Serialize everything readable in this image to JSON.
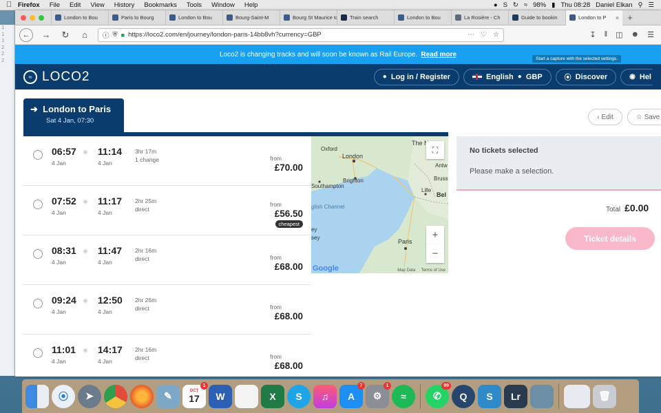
{
  "menubar": {
    "app": "Firefox",
    "items": [
      "File",
      "Edit",
      "View",
      "History",
      "Bookmarks",
      "Tools",
      "Window",
      "Help"
    ],
    "battery": "98%",
    "clock": "Thu 08:28",
    "user": "Daniel Elkan"
  },
  "tabs": [
    {
      "label": "London to Bou"
    },
    {
      "label": "Paris to Bourg"
    },
    {
      "label": "London to Bou"
    },
    {
      "label": "Bourg-Saint-M"
    },
    {
      "label": "Bourg St Maurice to"
    },
    {
      "label": "Train search"
    },
    {
      "label": "London to Bou"
    },
    {
      "label": "La Rosière - Ch"
    },
    {
      "label": "Guide to bookin"
    },
    {
      "label": "London to P"
    }
  ],
  "url": "https://loco2.com/en/journey/london-paris-14bb8vh?currency=GBP",
  "banner": {
    "text": "Loco2 is changing tracks and will soon be known as Rail Europe.",
    "link": "Read more",
    "capture": "Start a capture with the selected settings."
  },
  "header": {
    "logo": "LOCO2",
    "login": "Log in / Register",
    "language": "English",
    "currency": "GBP",
    "discover": "Discover",
    "help": "Hel"
  },
  "journey": {
    "route": "London to Paris",
    "date": "Sat 4 Jan, 07:30"
  },
  "results": [
    {
      "dep": "06:57",
      "dep_date": "4 Jan",
      "arr": "11:14",
      "arr_date": "4 Jan",
      "duration": "3hr 17m",
      "changes": "1 change",
      "from": "from",
      "price": "£70.00",
      "badge": ""
    },
    {
      "dep": "07:52",
      "dep_date": "4 Jan",
      "arr": "11:17",
      "arr_date": "4 Jan",
      "duration": "2hr 25m",
      "changes": "direct",
      "from": "from",
      "price": "£56.50",
      "badge": "cheapest"
    },
    {
      "dep": "08:31",
      "dep_date": "4 Jan",
      "arr": "11:47",
      "arr_date": "4 Jan",
      "duration": "2hr 16m",
      "changes": "direct",
      "from": "from",
      "price": "£68.00",
      "badge": ""
    },
    {
      "dep": "09:24",
      "dep_date": "4 Jan",
      "arr": "12:50",
      "arr_date": "4 Jan",
      "duration": "2hr 26m",
      "changes": "direct",
      "from": "from",
      "price": "£68.00",
      "badge": ""
    },
    {
      "dep": "11:01",
      "dep_date": "4 Jan",
      "arr": "14:17",
      "arr_date": "4 Jan",
      "duration": "2hr 16m",
      "changes": "direct",
      "from": "from",
      "price": "£68.00",
      "badge": ""
    }
  ],
  "map": {
    "labels": [
      "Oxford",
      "London",
      "Brighton",
      "Southampton",
      "The N",
      "Antw",
      "Bruss",
      "Lille",
      "Bel",
      "glish Channel",
      "ey",
      "sey",
      "Paris"
    ],
    "google": "Google",
    "map_data": "Map Data",
    "terms": "Terms of Use"
  },
  "actions": {
    "edit": "Edit",
    "save": "Save"
  },
  "basket": {
    "title": "No tickets selected",
    "subtitle": "Please make a selection.",
    "total_label": "Total",
    "total": "£0.00",
    "button": "Ticket details"
  },
  "dock": {
    "calendar_month": "OCT",
    "calendar_day": "17",
    "badges": {
      "calendar": "1",
      "appstore": "7",
      "settings": "1",
      "whatsapp": "99"
    }
  },
  "colors": {
    "brand": "#0a3d6e",
    "banner": "#1aa0f0",
    "cta": "#f9b8c9"
  }
}
